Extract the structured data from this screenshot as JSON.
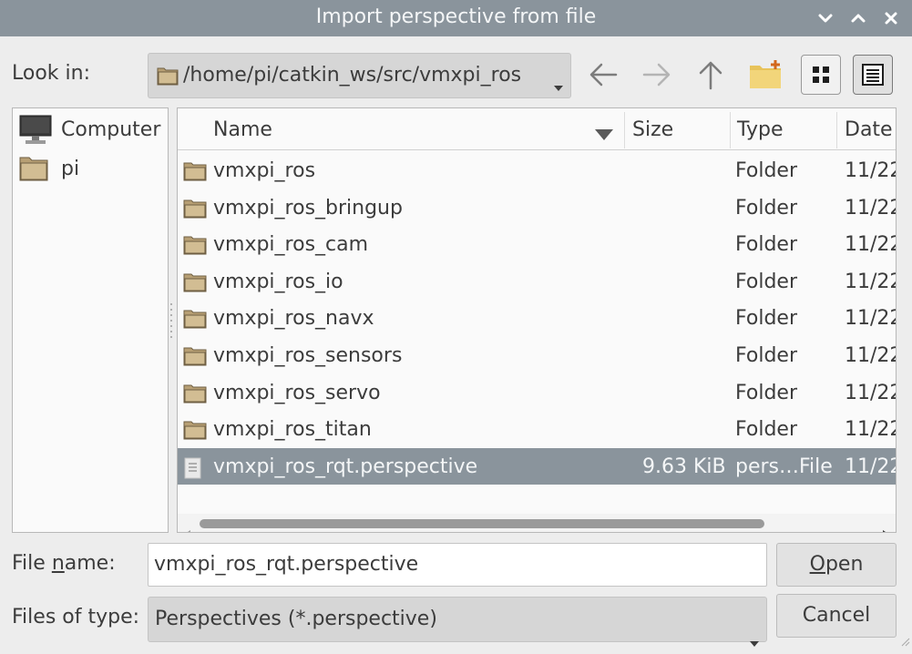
{
  "window": {
    "title": "Import perspective from file"
  },
  "look_in": {
    "label": "Look in:",
    "path": "/home/pi/catkin_ws/src/vmxpi_ros"
  },
  "places": [
    {
      "label": "Computer",
      "icon": "computer-icon"
    },
    {
      "label": "pi",
      "icon": "folder-icon"
    }
  ],
  "columns": {
    "name": "Name",
    "size": "Size",
    "type": "Type",
    "date": "Date"
  },
  "files": [
    {
      "name": "vmxpi_ros",
      "size": "",
      "type": "Folder",
      "date": "11/22",
      "icon": "folder-icon",
      "selected": false
    },
    {
      "name": "vmxpi_ros_bringup",
      "size": "",
      "type": "Folder",
      "date": "11/22",
      "icon": "folder-icon",
      "selected": false
    },
    {
      "name": "vmxpi_ros_cam",
      "size": "",
      "type": "Folder",
      "date": "11/22",
      "icon": "folder-icon",
      "selected": false
    },
    {
      "name": "vmxpi_ros_io",
      "size": "",
      "type": "Folder",
      "date": "11/22",
      "icon": "folder-icon",
      "selected": false
    },
    {
      "name": "vmxpi_ros_navx",
      "size": "",
      "type": "Folder",
      "date": "11/22",
      "icon": "folder-icon",
      "selected": false
    },
    {
      "name": "vmxpi_ros_sensors",
      "size": "",
      "type": "Folder",
      "date": "11/22",
      "icon": "folder-icon",
      "selected": false
    },
    {
      "name": "vmxpi_ros_servo",
      "size": "",
      "type": "Folder",
      "date": "11/22",
      "icon": "folder-icon",
      "selected": false
    },
    {
      "name": "vmxpi_ros_titan",
      "size": "",
      "type": "Folder",
      "date": "11/22",
      "icon": "folder-icon",
      "selected": false
    },
    {
      "name": "vmxpi_ros_rqt.perspective",
      "size": "9.63 KiB",
      "type": "pers…File",
      "date": "11/22",
      "icon": "file-icon",
      "selected": true
    }
  ],
  "file_name": {
    "label_pre": "File ",
    "label_mnemonic": "n",
    "label_post": "ame:",
    "value": "vmxpi_ros_rqt.perspective"
  },
  "file_type": {
    "label": "Files of type:",
    "value": "Perspectives (*.perspective)"
  },
  "buttons": {
    "open_mnemonic": "O",
    "open_rest": "pen",
    "cancel": "Cancel"
  },
  "colors": {
    "titlebar": "#8a949c",
    "selection": "#8a949c",
    "folder": "#c9b48a"
  }
}
